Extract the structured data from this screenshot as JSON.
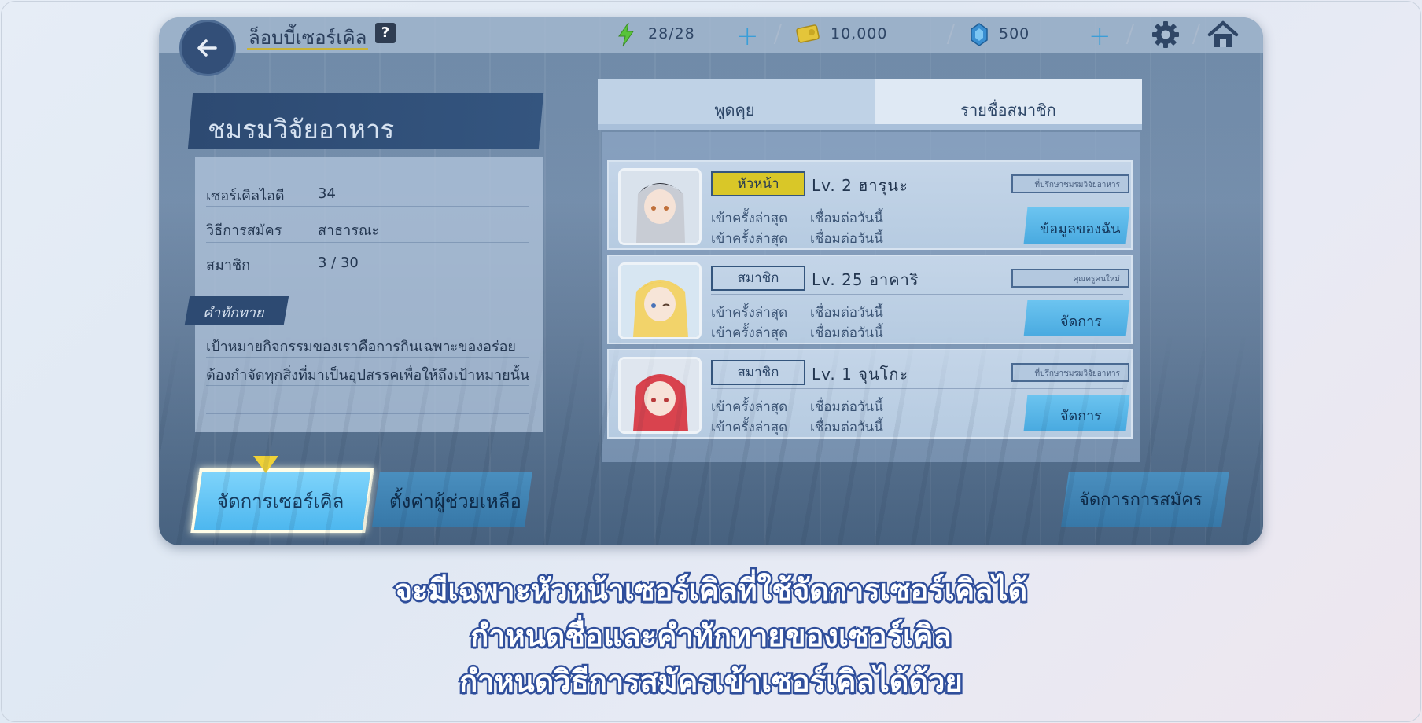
{
  "header": {
    "title": "ล็อบบี้เซอร์เคิล",
    "help": "?",
    "energy": "28/28",
    "credits": "10,000",
    "gems": "500"
  },
  "club": {
    "name": "ชมรมวิจัยอาหาร",
    "rows": [
      {
        "label": "เซอร์เคิลไอดี",
        "value": "34"
      },
      {
        "label": "วิธีการสมัคร",
        "value": "สาธารณะ"
      },
      {
        "label": "สมาชิก",
        "value": "3 / 30"
      }
    ],
    "greeting_label": "คำทักทาย",
    "greeting_lines": [
      "เป้าหมายกิจกรรมของเราคือการกินเฉพาะของอร่อย",
      "ต้องกำจัดทุกสิ่งที่มาเป็นอุปสรรคเพื่อให้ถึงเป้าหมายนั้น"
    ]
  },
  "tabs": {
    "chat": "พูดคุย",
    "members": "รายชื่อสมาชิก"
  },
  "members": [
    {
      "rank": "หัวหน้า",
      "lv_name": "Lv.  2  ฮารุนะ",
      "badge": "ที่ปรึกษาชมรมวิจัยอาหาร",
      "last_label_1": "เข้าครั้งล่าสุด",
      "last_value_1": "เชื่อมต่อวันนี้",
      "last_label_2": "เข้าครั้งล่าสุด",
      "last_value_2": "เชื่อมต่อวันนี้",
      "button": "ข้อมูลของฉัน"
    },
    {
      "rank": "สมาชิก",
      "lv_name": "Lv.  25  อาคาริ",
      "badge": "คุณครูคนใหม่",
      "last_label_1": "เข้าครั้งล่าสุด",
      "last_value_1": "เชื่อมต่อวันนี้",
      "last_label_2": "เข้าครั้งล่าสุด",
      "last_value_2": "เชื่อมต่อวันนี้",
      "button": "จัดการ"
    },
    {
      "rank": "สมาชิก",
      "lv_name": "Lv.  1  จุนโกะ",
      "badge": "ที่ปรึกษาชมรมวิจัยอาหาร",
      "last_label_1": "เข้าครั้งล่าสุด",
      "last_value_1": "เชื่อมต่อวันนี้",
      "last_label_2": "เข้าครั้งล่าสุด",
      "last_value_2": "เชื่อมต่อวันนี้",
      "button": "จัดการ"
    }
  ],
  "buttons": {
    "circle_manage": "จัดการเซอร์เคิล",
    "helper_settings": "ตั้งค่าผู้ช่วยเหลือ",
    "join_manage": "จัดการการสมัคร"
  },
  "caption": [
    "จะมีเฉพาะหัวหน้าเซอร์เคิลที่ใช้จัดการเซอร์เคิลได้",
    "กำหนดชื่อและคำทักทายของเซอร์เคิล",
    "กำหนดวิธีการสมัครเข้าเซอร์เคิลได้ด้วย"
  ],
  "colors": {
    "accent_blue": "#4db7ef",
    "leader_badge": "#d9c728",
    "caption_stroke": "#2f4e9b"
  }
}
